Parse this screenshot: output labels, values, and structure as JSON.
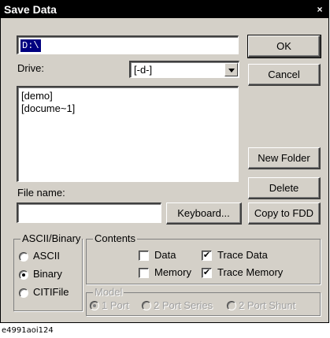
{
  "window": {
    "title": "Save Data",
    "close_glyph": "×"
  },
  "path_field": {
    "value": "D:\\"
  },
  "drive": {
    "label": "Drive:",
    "selected": "[-d-]"
  },
  "folder_list": {
    "items": [
      "[demo]",
      "[docume~1]"
    ]
  },
  "filename": {
    "label": "File name:",
    "value": ""
  },
  "buttons": {
    "ok": "OK",
    "cancel": "Cancel",
    "new_folder": "New Folder",
    "delete": "Delete",
    "keyboard": "Keyboard...",
    "copy_fdd": "Copy to FDD"
  },
  "format_group": {
    "title": "ASCII/Binary",
    "options": [
      {
        "label": "ASCII",
        "selected": false
      },
      {
        "label": "Binary",
        "selected": true
      },
      {
        "label": "CITIFile",
        "selected": false
      }
    ]
  },
  "contents_group": {
    "title": "Contents",
    "data": {
      "label": "Data",
      "checked": false
    },
    "memory": {
      "label": "Memory",
      "checked": false
    },
    "trace_data": {
      "label": "Trace Data",
      "checked": true
    },
    "trace_memory": {
      "label": "Trace Memory",
      "checked": true
    },
    "check_glyph": "✔"
  },
  "model_group": {
    "title": "Model",
    "options": [
      {
        "label": "1 Port",
        "selected": true
      },
      {
        "label": "2 Port Series",
        "selected": false
      },
      {
        "label": "2 Port Shunt",
        "selected": false
      }
    ]
  },
  "figure_caption": "e4991aoi124"
}
